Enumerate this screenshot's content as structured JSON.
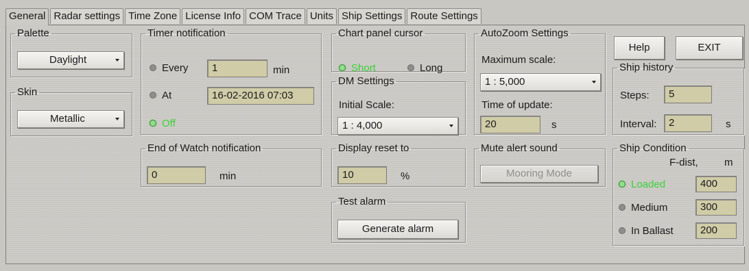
{
  "tabs": [
    "General",
    "Radar settings",
    "Time Zone",
    "License Info",
    "COM Trace",
    "Units",
    "Ship Settings",
    "Route Settings"
  ],
  "palette": {
    "title": "Palette",
    "value": "Daylight"
  },
  "skin": {
    "title": "Skin",
    "value": "Metallic"
  },
  "timer": {
    "title": "Timer notification",
    "every_label": "Every",
    "every_value": "1",
    "every_unit": "min",
    "at_label": "At",
    "at_value": "16-02-2016 07:03",
    "off_label": "Off",
    "selected": "off"
  },
  "chart_cursor": {
    "title": "Chart panel cursor",
    "short_label": "Short",
    "long_label": "Long",
    "selected": "short"
  },
  "dm_settings": {
    "title": "DM Settings",
    "initial_scale_label": "Initial Scale:",
    "initial_scale_value": "1 : 4,000"
  },
  "autozoom": {
    "title": "AutoZoom Settings",
    "max_scale_label": "Maximum scale:",
    "max_scale_value": "1 : 5,000",
    "update_label": "Time of update:",
    "update_value": "20",
    "update_unit": "s"
  },
  "buttons": {
    "help": "Help",
    "exit": "EXIT"
  },
  "ship_history": {
    "title": "Ship history",
    "steps_label": "Steps:",
    "steps_value": "5",
    "interval_label": "Interval:",
    "interval_value": "2",
    "interval_unit": "s"
  },
  "end_watch": {
    "title": "End of Watch notification",
    "value": "0",
    "unit": "min"
  },
  "display_reset": {
    "title": "Display reset to",
    "value": "10",
    "unit": "%"
  },
  "mute_alert": {
    "title": "Mute alert sound",
    "button": "Mooring Mode"
  },
  "test_alarm": {
    "title": "Test alarm",
    "button": "Generate alarm"
  },
  "ship_condition": {
    "title": "Ship Condition",
    "col_header": "F-dist,",
    "col_unit": "m",
    "rows": [
      {
        "label": "Loaded",
        "value": "400"
      },
      {
        "label": "Medium",
        "value": "300"
      },
      {
        "label": "In Ballast",
        "value": "200"
      }
    ],
    "selected": "Loaded"
  }
}
